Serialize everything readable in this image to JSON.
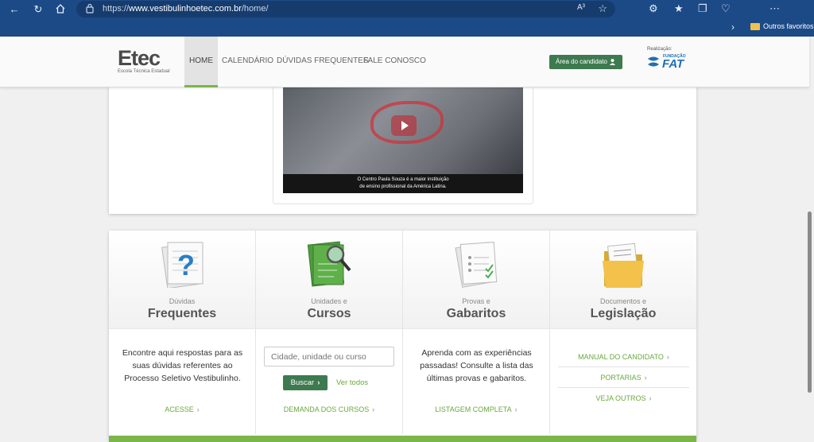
{
  "browser": {
    "url_prefix": "https://",
    "url_domain": "www.vestibulinhoetec.com.br",
    "url_path": "/home/",
    "read_aloud": "A³",
    "favorites_folder": "Outros favoritos"
  },
  "header": {
    "logo_big": "Etec",
    "logo_small": "Escola Técnica Estadual",
    "nav": [
      "HOME",
      "CALENDÁRIO",
      "DÚVIDAS FREQUENTES",
      "FALE CONOSCO"
    ],
    "area_button": "Área do candidato",
    "realizacao": "Realização:",
    "fat_small": "FUNDAÇÃO",
    "fat_big": "FAT"
  },
  "video": {
    "caption_line1": "O Centro Paula Souza é a maior instituição",
    "caption_line2": "de ensino profissional da América Latina."
  },
  "cards": [
    {
      "sub": "Dúvidas",
      "title": "Frequentes",
      "icon": "question-document-icon",
      "text": "Encontre aqui respostas para as suas dúvidas referentes ao Processo Seletivo Vestibulinho.",
      "link": "ACESSE"
    },
    {
      "sub": "Unidades e",
      "title": "Cursos",
      "icon": "course-search-icon",
      "search_placeholder": "Cidade, unidade ou curso",
      "search_button": "Buscar",
      "see_all": "Ver todos",
      "link": "DEMANDA DOS CURSOS"
    },
    {
      "sub": "Provas e",
      "title": "Gabaritos",
      "icon": "answer-sheet-icon",
      "text": "Aprenda com as experiências passadas! Consulte a lista das últimas provas e gabaritos.",
      "link": "LISTAGEM COMPLETA"
    },
    {
      "sub": "Documentos e",
      "title": "Legislação",
      "icon": "folder-documents-icon",
      "links": [
        "MANUAL DO CANDIDATO",
        "PORTARIAS",
        "VEJA OUTROS"
      ]
    }
  ],
  "colors": {
    "chrome": "#1c4a87",
    "accent_green": "#7ab648",
    "button_green": "#3d7a4f"
  }
}
